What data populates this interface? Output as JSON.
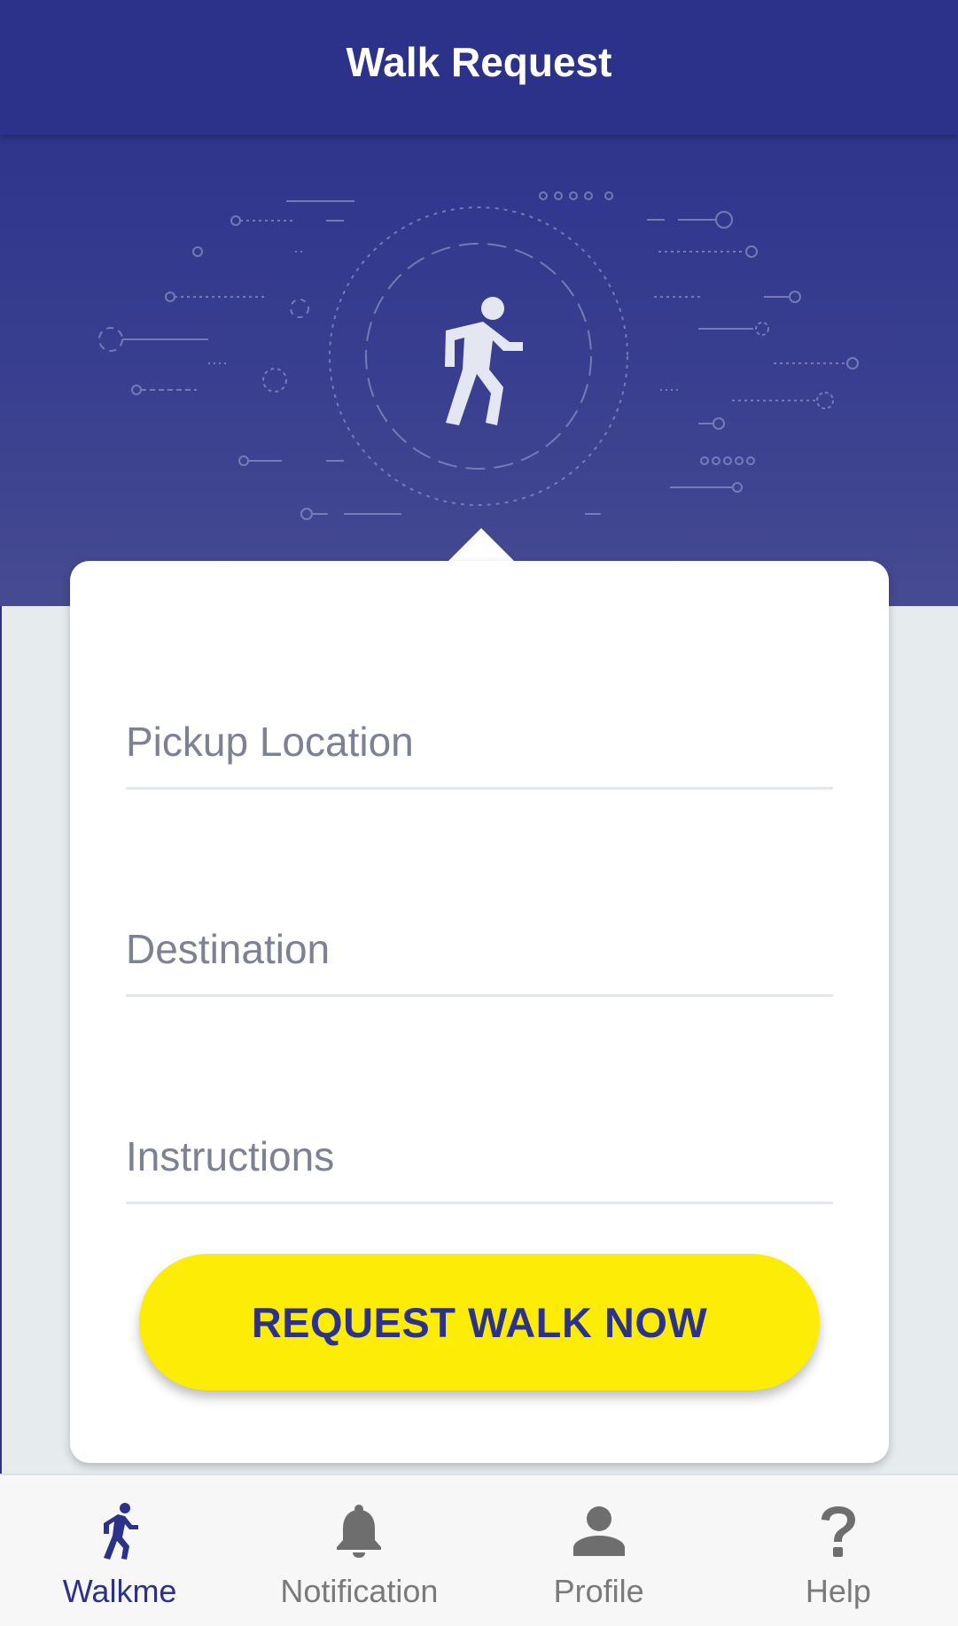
{
  "header": {
    "title": "Walk Request"
  },
  "hero": {
    "icon": "walking-person-icon"
  },
  "form": {
    "fields": [
      {
        "label": "Pickup Location",
        "value": ""
      },
      {
        "label": "Destination",
        "value": ""
      },
      {
        "label": "Instructions",
        "value": ""
      }
    ],
    "submit_label": "REQUEST WALK NOW"
  },
  "bottom_nav": {
    "items": [
      {
        "label": "Walkme",
        "icon": "walking-person-icon",
        "active": true
      },
      {
        "label": "Notification",
        "icon": "bell-icon",
        "active": false
      },
      {
        "label": "Profile",
        "icon": "person-icon",
        "active": false
      },
      {
        "label": "Help",
        "icon": "question-icon",
        "active": false
      }
    ]
  },
  "colors": {
    "primary": "#2c318a",
    "accent": "#fdec06",
    "background": "#e6ebee",
    "inactive": "#7a7a7a"
  }
}
